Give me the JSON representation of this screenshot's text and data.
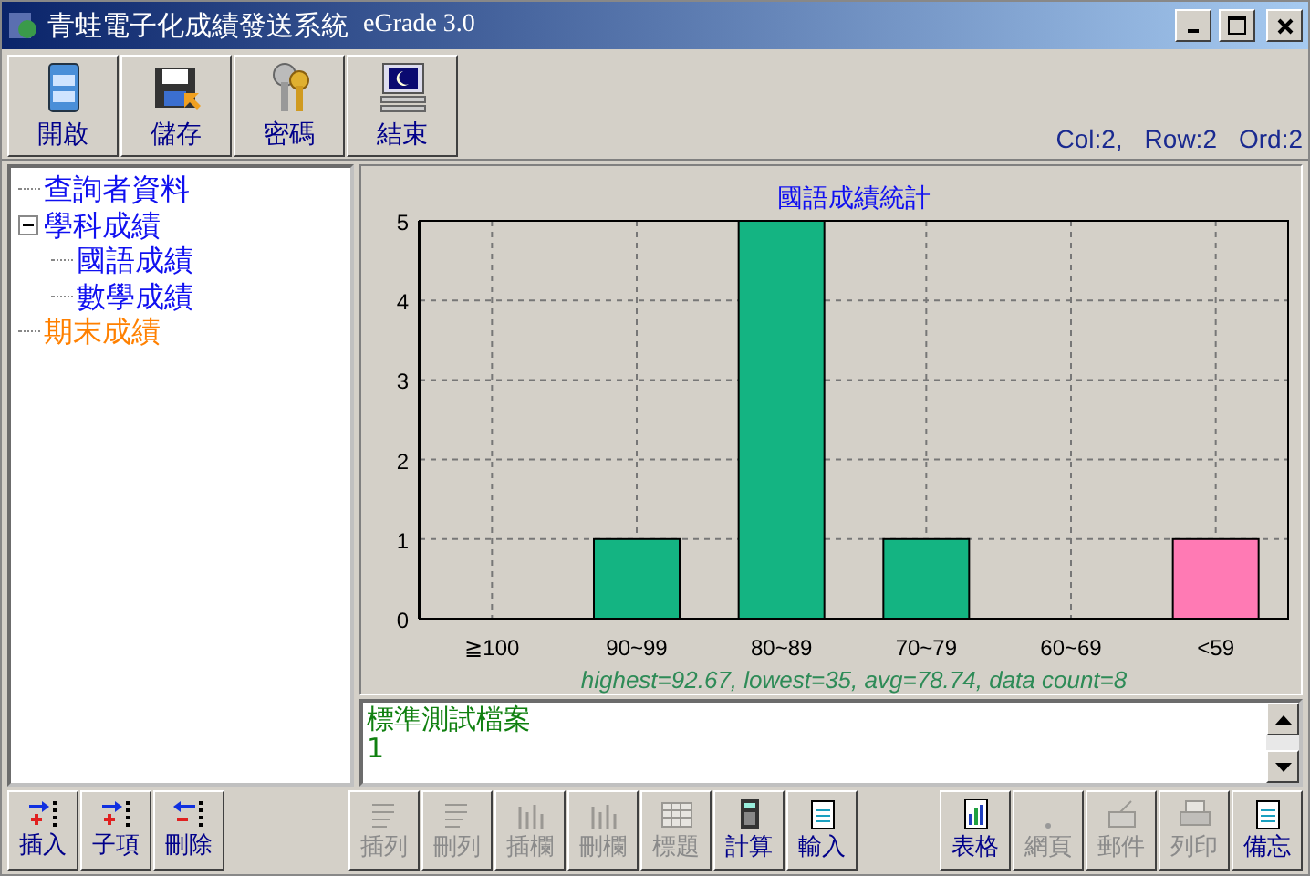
{
  "window": {
    "title": "青蛙電子化成績發送系統",
    "version": "eGrade 3.0"
  },
  "toolbar": [
    {
      "label": "開啟",
      "kind": "cabinet"
    },
    {
      "label": "儲存",
      "kind": "disk"
    },
    {
      "label": "密碼",
      "kind": "keys"
    },
    {
      "label": "結束",
      "kind": "monitor"
    }
  ],
  "status": [
    "Col:2,",
    "Row:2",
    "Ord:2"
  ],
  "tree": [
    {
      "label": "查詢者資料",
      "selected": false
    },
    {
      "label": "學科成績",
      "selected": false,
      "expanded": true,
      "children": [
        {
          "label": "國語成績",
          "selected": false
        },
        {
          "label": "數學成績",
          "selected": false
        }
      ]
    },
    {
      "label": "期末成績",
      "selected": true
    }
  ],
  "chart": {
    "chart_data": {
      "type": "bar",
      "title": "國語成績統計",
      "categories": [
        "≧100",
        "90~99",
        "80~89",
        "70~79",
        "60~69",
        "<59"
      ],
      "stacked": true,
      "grid": true,
      "series": [
        {
          "color": "#14b482",
          "values": [
            0,
            1,
            5,
            1,
            0,
            null
          ]
        },
        {
          "color": "#ff7ab4",
          "values": [
            null,
            null,
            null,
            null,
            null,
            1
          ]
        }
      ],
      "ylim": [
        0,
        5
      ],
      "yticks": [
        0,
        1,
        2,
        3,
        4,
        5
      ]
    },
    "summary": "highest=92.67,  lowest=35,  avg=78.74,   data count=8"
  },
  "memo": [
    "標準測試檔案",
    "1"
  ],
  "tree_buttons": [
    {
      "label": "插入",
      "kind": "insert"
    },
    {
      "label": "子項",
      "kind": "insert"
    },
    {
      "label": "刪除",
      "kind": "remove"
    }
  ],
  "grid_buttons": [
    {
      "label": "插列",
      "disabled": true,
      "kind": "rows"
    },
    {
      "label": "刪列",
      "disabled": true,
      "kind": "rows"
    },
    {
      "label": "插欄",
      "disabled": true,
      "kind": "cols"
    },
    {
      "label": "刪欄",
      "disabled": true,
      "kind": "cols"
    },
    {
      "label": "標題",
      "disabled": true,
      "kind": "table"
    },
    {
      "label": "計算",
      "disabled": false,
      "kind": "calc"
    },
    {
      "label": "輸入",
      "disabled": false,
      "kind": "pad"
    }
  ],
  "output_buttons": [
    {
      "label": "表格",
      "disabled": false,
      "kind": "chart"
    },
    {
      "label": "網頁",
      "disabled": true,
      "kind": "dot"
    },
    {
      "label": "郵件",
      "disabled": true,
      "kind": "mail"
    },
    {
      "label": "列印",
      "disabled": true,
      "kind": "printer"
    },
    {
      "label": "備忘",
      "disabled": false,
      "kind": "pad"
    }
  ]
}
